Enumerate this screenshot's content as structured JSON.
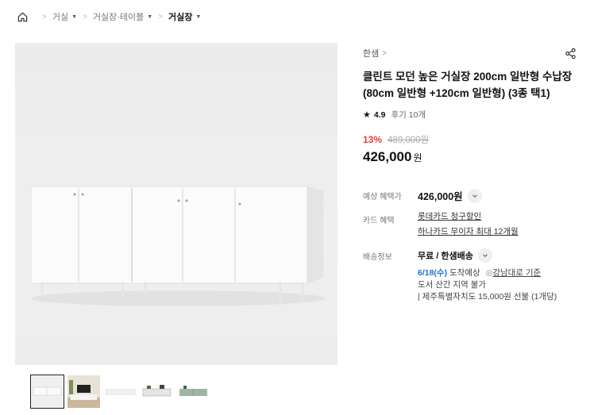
{
  "breadcrumb": {
    "items": [
      {
        "label": "거실"
      },
      {
        "label": "거실장·테이블"
      },
      {
        "label": "거실장"
      }
    ]
  },
  "icons": {
    "home": "home-icon",
    "share": "share-icon",
    "star": "star-icon",
    "chevron": "chevron-down-icon",
    "pin": "location-pin-icon"
  },
  "product": {
    "brand": "한샘",
    "title": "클린트 모던 높은 거실장 200cm 일반형 수납장(80cm 일반형 +120cm 일반형) (3종 택1)",
    "rating": "4.9",
    "reviews": "후기 10개",
    "discount": "13%",
    "original_price": "489,000원",
    "price": "426,000",
    "price_unit": "원"
  },
  "benefits": {
    "expected_label": "예상 혜택가",
    "expected_value": "426,000원",
    "card_label": "카드 혜택",
    "card_links": [
      "롯데카드 청구할인",
      "하나카드 무이자 최대 12개월"
    ],
    "shipping_label": "배송정보",
    "shipping_value": "무료 / 한샘배송",
    "arrival_date": "6/18(수)",
    "arrival_text": "도착예상",
    "arrival_location": "강남대로 기준",
    "notice_1": "도서 산간 지역 불가",
    "notice_2": "| 제주특별자치도 15,000원 선불 (1개당)"
  },
  "colors": {
    "discount": "#ea3a3a",
    "arrival": "#1e73d6"
  }
}
